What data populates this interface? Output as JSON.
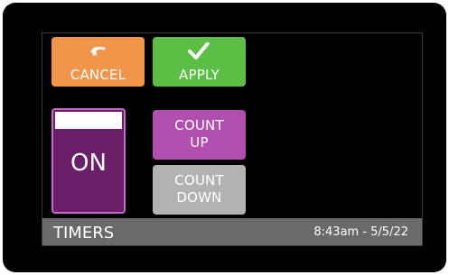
{
  "header": {
    "cancel_label": "CANCEL",
    "apply_label": "APPLY"
  },
  "toggle": {
    "state": "ON"
  },
  "mode": {
    "count_up_line1": "COUNT",
    "count_up_line2": "UP",
    "count_down_line1": "COUNT",
    "count_down_line2": "DOWN"
  },
  "footer": {
    "title": "TIMERS",
    "datetime": "8:43am - 5/5/22"
  },
  "colors": {
    "cancel": "#f0954a",
    "apply": "#5bbf45",
    "toggle_on": "#6b1f69",
    "count_up": "#b04fb0",
    "count_down": "#b2b2b2",
    "footer": "#6a6a6a"
  },
  "icons": {
    "cancel": "undo-arrow-icon",
    "apply": "checkmark-icon"
  }
}
